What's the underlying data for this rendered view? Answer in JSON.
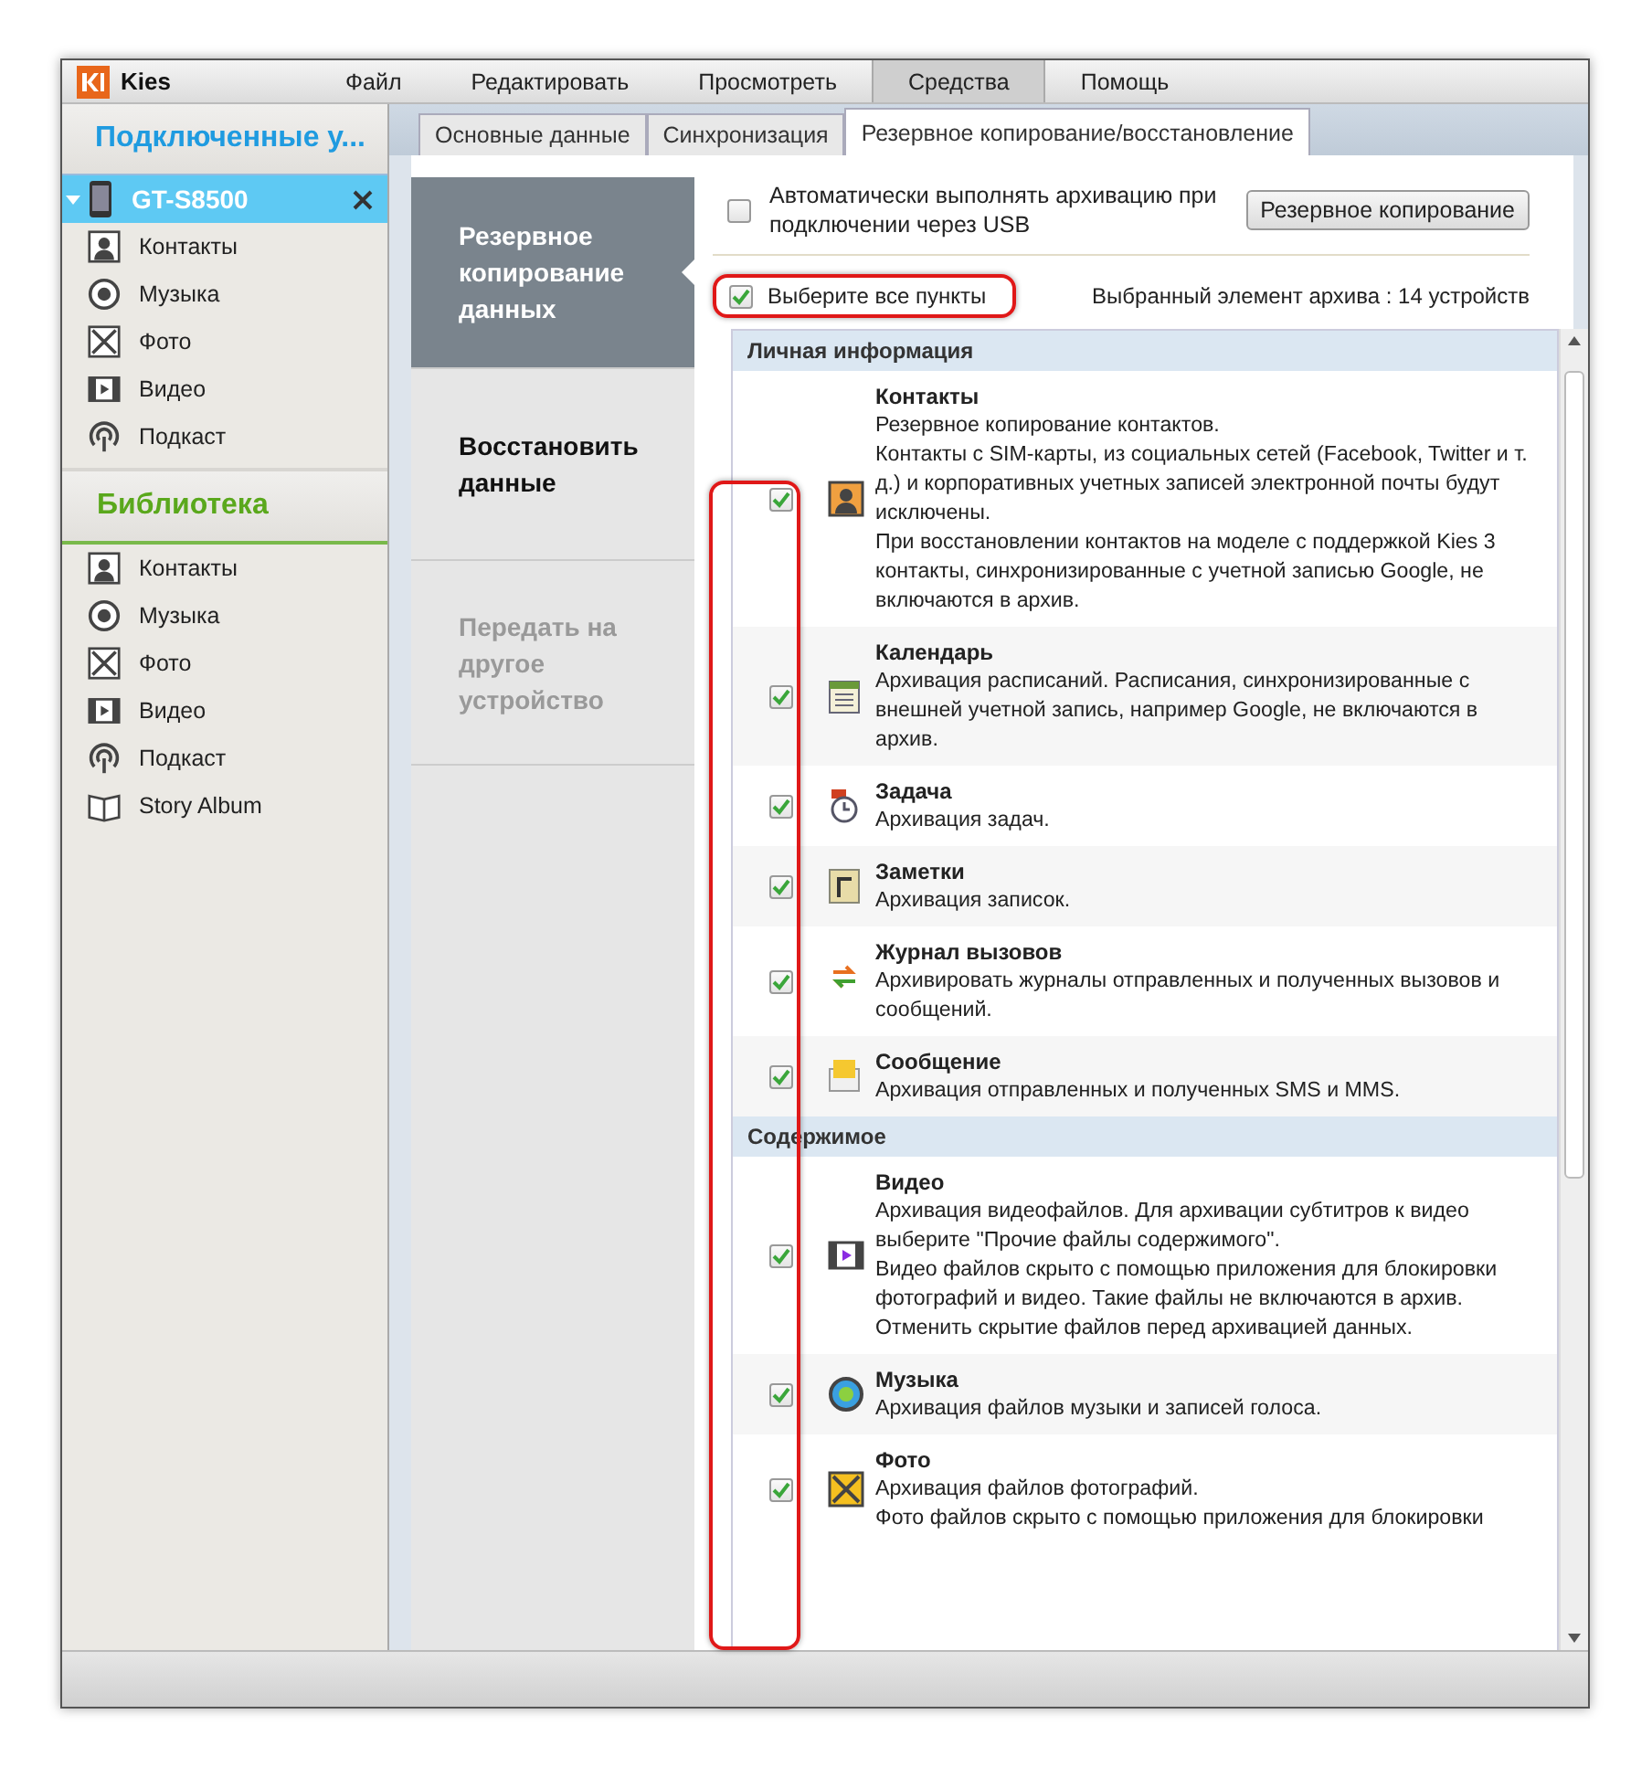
{
  "app": {
    "title": "Kies"
  },
  "menu": [
    {
      "label": "Файл",
      "selected": false
    },
    {
      "label": "Редактировать",
      "selected": false
    },
    {
      "label": "Просмотреть",
      "selected": false
    },
    {
      "label": "Средства",
      "selected": true
    },
    {
      "label": "Помощь",
      "selected": false
    }
  ],
  "sidebar": {
    "connected_header": "Подключенные у...",
    "device": {
      "name": "GT-S8500",
      "expanded": true
    },
    "device_items": [
      {
        "label": "Контакты",
        "kind": "contacts"
      },
      {
        "label": "Музыка",
        "kind": "music"
      },
      {
        "label": "Фото",
        "kind": "photo"
      },
      {
        "label": "Видео",
        "kind": "video"
      },
      {
        "label": "Подкаст",
        "kind": "podcast"
      }
    ],
    "library_header": "Библиотека",
    "library_items": [
      {
        "label": "Контакты",
        "kind": "contacts"
      },
      {
        "label": "Музыка",
        "kind": "music"
      },
      {
        "label": "Фото",
        "kind": "photo"
      },
      {
        "label": "Видео",
        "kind": "video"
      },
      {
        "label": "Подкаст",
        "kind": "podcast"
      },
      {
        "label": "Story Album",
        "kind": "album"
      }
    ]
  },
  "tabs": [
    {
      "label": "Основные данные",
      "selected": false
    },
    {
      "label": "Синхронизация",
      "selected": false
    },
    {
      "label": "Резервное копирование/восстановление",
      "selected": true
    }
  ],
  "nav": [
    {
      "label": "Резервное копирование данных",
      "selected": true,
      "disabled": false
    },
    {
      "label": "Восстановить данные",
      "selected": false,
      "disabled": false
    },
    {
      "label": "Передать на другое устройство",
      "selected": false,
      "disabled": true
    }
  ],
  "auto_backup": {
    "label": "Автоматически выполнять архивацию при подключении через USB",
    "checked": false
  },
  "backup_button": "Резервное копирование",
  "select_all": {
    "label": "Выберите все пункты",
    "checked": true,
    "highlighted": true
  },
  "selected_count": "Выбранный элемент архива :  14 устройств",
  "checkbox_column_highlighted": true,
  "sections": [
    {
      "title": "Личная информация",
      "items": [
        {
          "name": "Контакты",
          "kind": "contacts",
          "checked": true,
          "lines": [
            "Резервное копирование контактов.",
            "Контакты с SIM-карты, из социальных сетей (Facebook, Twitter и т. д.) и корпоративных учетных записей электронной почты будут исключены.",
            "При восстановлении контактов на моделе с поддержкой Kies 3 контакты, синхронизированные с учетной записью Google, не включаются в архив."
          ]
        },
        {
          "name": "Календарь",
          "kind": "calendar",
          "checked": true,
          "lines": [
            "Архивация расписаний. Расписания, синхронизированные с внешней учетной запись, например Google, не включаются в архив."
          ]
        },
        {
          "name": "Задача",
          "kind": "task",
          "checked": true,
          "lines": [
            "Архивация задач."
          ]
        },
        {
          "name": "Заметки",
          "kind": "memo",
          "checked": true,
          "lines": [
            "Архивация записок."
          ]
        },
        {
          "name": "Журнал вызовов",
          "kind": "calls",
          "checked": true,
          "lines": [
            "Архивировать журналы отправленных и полученных вызовов и сообщений."
          ]
        },
        {
          "name": "Сообщение",
          "kind": "message",
          "checked": true,
          "lines": [
            "Архивация отправленных и полученных SMS и MMS."
          ]
        }
      ]
    },
    {
      "title": "Содержимое",
      "items": [
        {
          "name": "Видео",
          "kind": "video",
          "checked": true,
          "lines": [
            "Архивация видеофайлов. Для архивации субтитров к видео выберите \"Прочие файлы содержимого\".",
            "Видео файлов скрыто с помощью приложения для блокировки фотографий и видео. Такие файлы не включаются в архив.",
            "Отменить скрытие файлов перед архивацией данных."
          ]
        },
        {
          "name": "Музыка",
          "kind": "music",
          "checked": true,
          "lines": [
            "Архивация файлов музыки и записей голоса."
          ]
        },
        {
          "name": "Фото",
          "kind": "photo",
          "checked": true,
          "lines": [
            "Архивация файлов фотографий.",
            "Фото файлов скрыто с помощью приложения для блокировки"
          ]
        }
      ]
    }
  ]
}
